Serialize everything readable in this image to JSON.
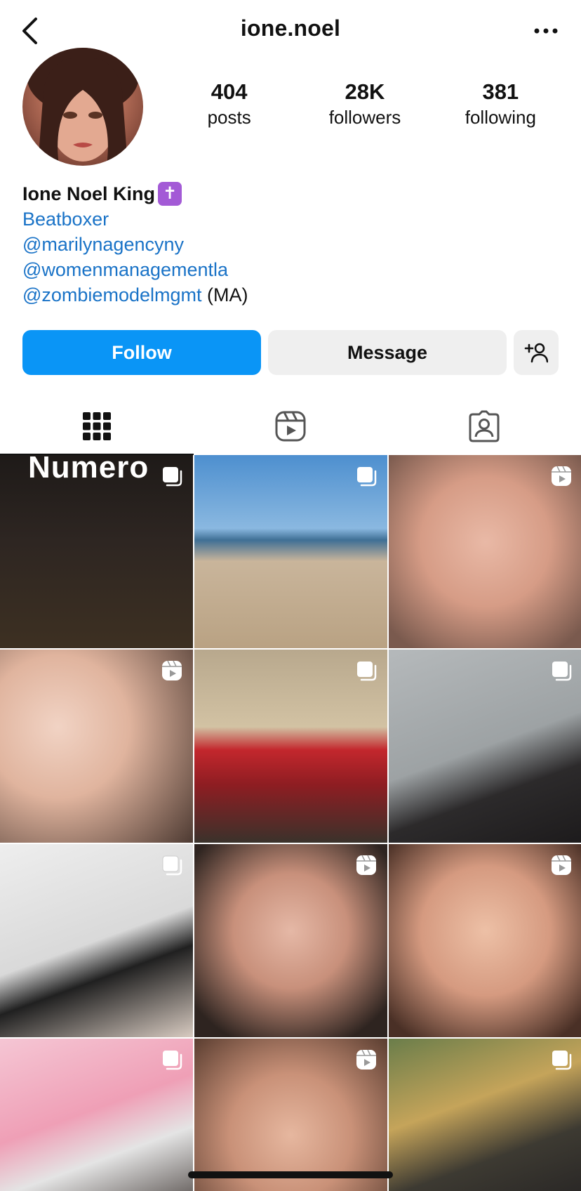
{
  "header": {
    "username": "ione.noel"
  },
  "profile": {
    "stats": [
      {
        "value": "404",
        "label": "posts"
      },
      {
        "value": "28K",
        "label": "followers"
      },
      {
        "value": "381",
        "label": "following"
      }
    ],
    "display_name": "Ione Noel King",
    "name_emoji": "✝",
    "bio_lines": [
      {
        "text": "Beatboxer",
        "suffix": ""
      },
      {
        "text": "@marilynagencyny",
        "suffix": ""
      },
      {
        "text": "@womenmanagementla",
        "suffix": ""
      },
      {
        "text": "@zombiemodelmgmt",
        "suffix": " (MA)"
      }
    ]
  },
  "actions": {
    "follow_label": "Follow",
    "message_label": "Message",
    "colors": {
      "follow_bg": "#0a95f6",
      "secondary_bg": "#efefef"
    }
  },
  "tabs": [
    {
      "icon": "grid-icon",
      "active": true
    },
    {
      "icon": "reels-icon",
      "active": false
    },
    {
      "icon": "tagged-icon",
      "active": false
    }
  ],
  "grid": {
    "posts": [
      {
        "type": "carousel",
        "caption": "Numero"
      },
      {
        "type": "carousel"
      },
      {
        "type": "reel"
      },
      {
        "type": "reel"
      },
      {
        "type": "carousel"
      },
      {
        "type": "carousel"
      },
      {
        "type": "carousel"
      },
      {
        "type": "reel"
      },
      {
        "type": "reel"
      },
      {
        "type": "carousel"
      },
      {
        "type": "reel"
      },
      {
        "type": "carousel"
      }
    ]
  }
}
